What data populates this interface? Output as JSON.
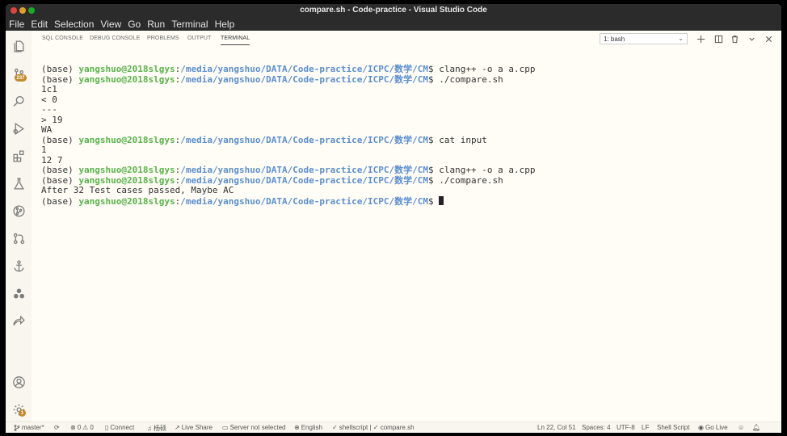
{
  "window": {
    "title": "compare.sh - Code-practice - Visual Studio Code"
  },
  "menu": [
    "File",
    "Edit",
    "Selection",
    "View",
    "Go",
    "Run",
    "Terminal",
    "Help"
  ],
  "activity": {
    "badge_source_control": "237",
    "badge_settings": "1"
  },
  "panel": {
    "tabs": [
      "SQL CONSOLE",
      "DEBUG CONSOLE",
      "PROBLEMS",
      "OUTPUT",
      "TERMINAL"
    ],
    "active_tab": "TERMINAL",
    "terminal_select": "1: bash"
  },
  "terminal": {
    "prompt_env": "(base) ",
    "prompt_user": "yangshuo@2018slgys",
    "prompt_sep": ":",
    "prompt_path": "/media/yangshuo/DATA/Code-practice/ICPC/数学/CM",
    "prompt_end": "$ ",
    "lines": [
      {
        "type": "prompt",
        "cmd": "clang++ -o a a.cpp"
      },
      {
        "type": "prompt",
        "cmd": "./compare.sh"
      },
      {
        "type": "out",
        "text": "1c1"
      },
      {
        "type": "out",
        "text": "< 0"
      },
      {
        "type": "out",
        "text": "---"
      },
      {
        "type": "out",
        "text": "> 19"
      },
      {
        "type": "out",
        "text": "WA"
      },
      {
        "type": "prompt",
        "cmd": "cat input"
      },
      {
        "type": "out",
        "text": "1"
      },
      {
        "type": "out",
        "text": "12 7"
      },
      {
        "type": "prompt",
        "cmd": "clang++ -o a a.cpp"
      },
      {
        "type": "prompt",
        "cmd": "./compare.sh"
      },
      {
        "type": "out",
        "text": "After 32 Test cases passed, Maybe AC"
      },
      {
        "type": "prompt",
        "cmd": "",
        "cursor": true
      }
    ]
  },
  "status": {
    "branch": "master*",
    "errors": "0",
    "warnings": "0",
    "connect": "Connect",
    "pinyin": "杨硕",
    "live_share": "Live Share",
    "server": "Server not selected",
    "language_ui": "English",
    "lint": "shellscript | ✓ compare.sh",
    "position": "Ln 22, Col 51",
    "spaces": "Spaces: 4",
    "encoding": "UTF-8",
    "eol": "LF",
    "lang_mode": "Shell Script",
    "go_live": "Go Live"
  }
}
